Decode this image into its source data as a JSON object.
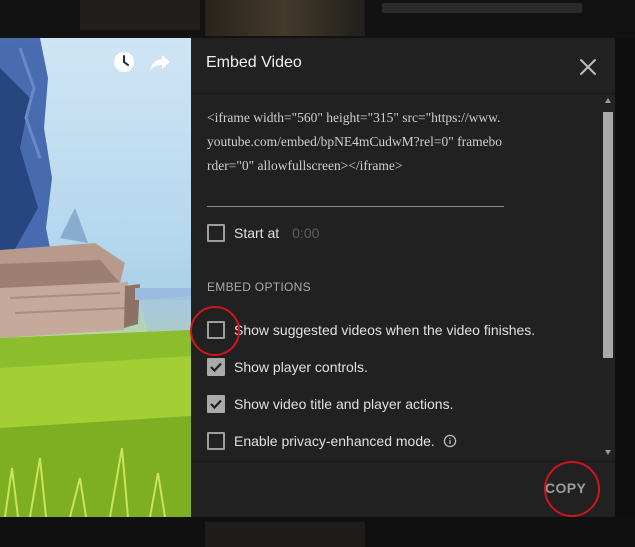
{
  "dialog": {
    "title": "Embed Video",
    "close_icon": "close-icon",
    "embed_code": "<iframe width=\"560\" height=\"315\" src=\"https://www.youtube.com/embed/bpNE4mCudwM?rel=0\" frameborder=\"0\" allowfullscreen></iframe>",
    "start_at": {
      "label": "Start at",
      "value": "0:00",
      "checked": false
    },
    "section_title": "EMBED OPTIONS",
    "options": [
      {
        "label": "Show suggested videos when the video finishes.",
        "checked": false
      },
      {
        "label": "Show player controls.",
        "checked": true
      },
      {
        "label": "Show video title and player actions.",
        "checked": true
      },
      {
        "label": "Enable privacy-enhanced mode.",
        "checked": false,
        "icon": "info-icon"
      }
    ],
    "copy_label": "COPY"
  },
  "video": {
    "watch_later_icon": "clock-icon",
    "share_icon": "share-arrow-icon"
  },
  "colors": {
    "dialog_bg": "#212121",
    "annotation": "#d2141c"
  }
}
